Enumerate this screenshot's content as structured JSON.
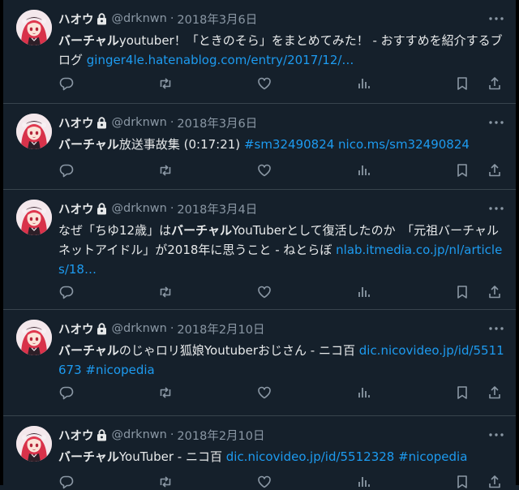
{
  "colors": {
    "background": "#15202b",
    "text": "#e7e9ea",
    "muted": "#8b98a5",
    "link": "#1d9bf0",
    "divider": "#38444d"
  },
  "icons": [
    "lock-icon",
    "more-icon",
    "reply-icon",
    "retweet-icon",
    "like-icon",
    "views-icon",
    "bookmark-icon",
    "share-icon"
  ],
  "tweets": [
    {
      "name": "ハオウ",
      "handle": "@drknwn",
      "dot": "·",
      "date": "2018年3月6日",
      "segments": [
        {
          "t": "hl",
          "v": "バーチャル"
        },
        {
          "t": "plain",
          "v": "youtuber！「ときのそら」をまとめてみた！ - おすすめを紹介するブログ "
        },
        {
          "t": "link",
          "v": "ginger4le.hatenablog.com/entry/2017/12/…"
        }
      ]
    },
    {
      "name": "ハオウ",
      "handle": "@drknwn",
      "dot": "·",
      "date": "2018年3月6日",
      "segments": [
        {
          "t": "hl",
          "v": "バーチャル"
        },
        {
          "t": "plain",
          "v": "放送事故集 (0:17:21) "
        },
        {
          "t": "link",
          "v": "#sm32490824 nico.ms/sm32490824"
        }
      ]
    },
    {
      "name": "ハオウ",
      "handle": "@drknwn",
      "dot": "·",
      "date": "2018年3月4日",
      "segments": [
        {
          "t": "plain",
          "v": "なぜ「ちゆ12歳」は"
        },
        {
          "t": "hl",
          "v": "バーチャル"
        },
        {
          "t": "plain",
          "v": "YouTuberとして復活したのか　「元祖バーチャルネットアイドル」が2018年に思うこと - ねとらぼ "
        },
        {
          "t": "link",
          "v": "nlab.itmedia.co.jp/nl/articles/18…"
        }
      ]
    },
    {
      "name": "ハオウ",
      "handle": "@drknwn",
      "dot": "·",
      "date": "2018年2月10日",
      "segments": [
        {
          "t": "hl",
          "v": "バーチャル"
        },
        {
          "t": "plain",
          "v": "のじゃロリ狐娘Youtuberおじさん - ニコ百 "
        },
        {
          "t": "link",
          "v": "dic.nicovideo.jp/id/5511673 #nicopedia"
        }
      ]
    },
    {
      "name": "ハオウ",
      "handle": "@drknwn",
      "dot": "·",
      "date": "2018年2月10日",
      "segments": [
        {
          "t": "hl",
          "v": "バーチャル"
        },
        {
          "t": "plain",
          "v": "YouTuber - ニコ百 "
        },
        {
          "t": "link",
          "v": "dic.nicovideo.jp/id/5512328 #nicopedia"
        }
      ]
    }
  ]
}
